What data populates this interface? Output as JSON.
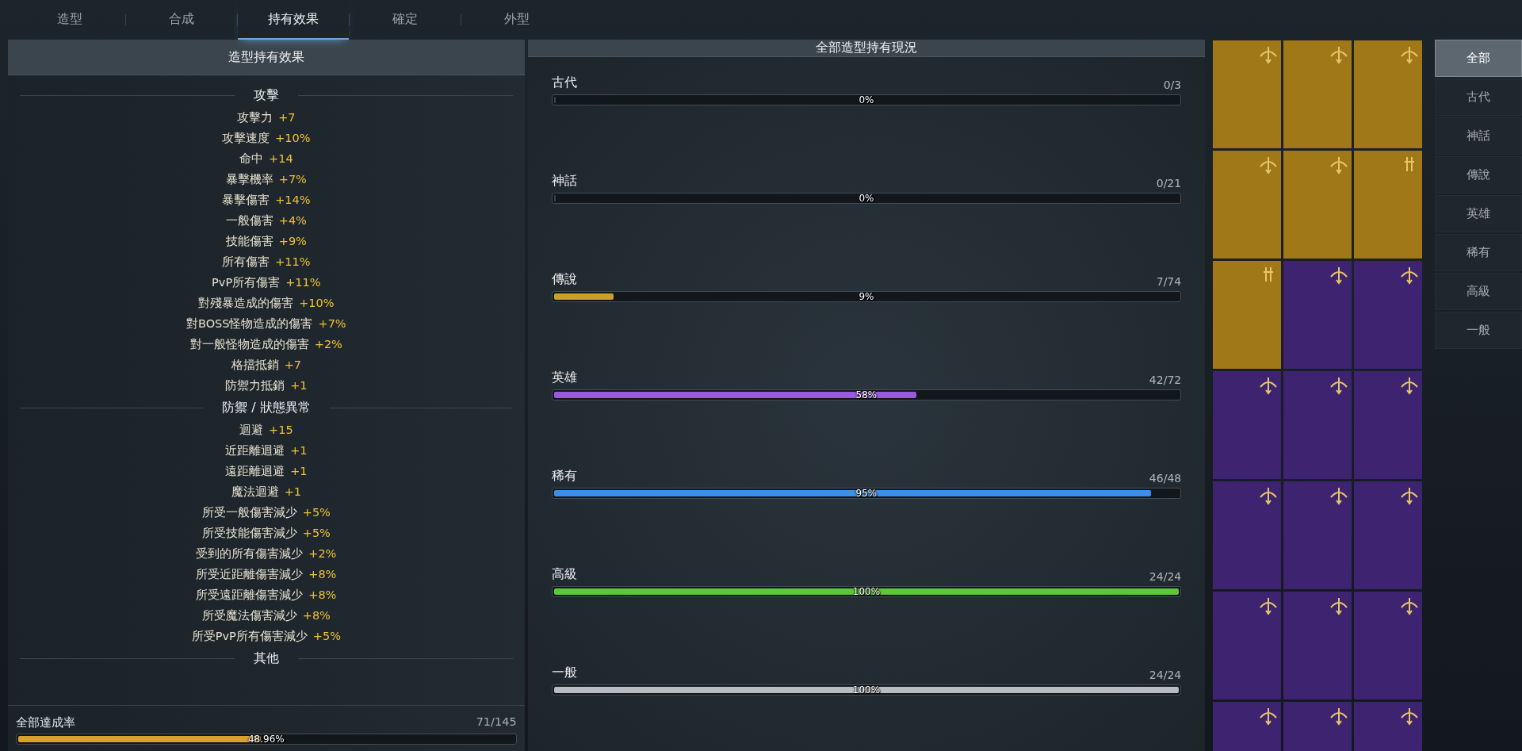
{
  "tabs": [
    {
      "label": "造型",
      "selected": false
    },
    {
      "label": "合成",
      "selected": false
    },
    {
      "label": "持有效果",
      "selected": true
    },
    {
      "label": "確定",
      "selected": false
    },
    {
      "label": "外型",
      "selected": false
    }
  ],
  "effects_panel": {
    "title": "造型持有效果",
    "sections": [
      {
        "title": "攻擊",
        "stats": [
          {
            "name": "攻擊力",
            "value": "+7"
          },
          {
            "name": "攻擊速度",
            "value": "+10%"
          },
          {
            "name": "命中",
            "value": "+14"
          },
          {
            "name": "暴擊機率",
            "value": "+7%"
          },
          {
            "name": "暴擊傷害",
            "value": "+14%"
          },
          {
            "name": "一般傷害",
            "value": "+4%"
          },
          {
            "name": "技能傷害",
            "value": "+9%"
          },
          {
            "name": "所有傷害",
            "value": "+11%"
          },
          {
            "name": "PvP所有傷害",
            "value": "+11%"
          },
          {
            "name": "對殘暴造成的傷害",
            "value": "+10%"
          },
          {
            "name": "對BOSS怪物造成的傷害",
            "value": "+7%"
          },
          {
            "name": "對一般怪物造成的傷害",
            "value": "+2%"
          },
          {
            "name": "格擋抵銷",
            "value": "+7"
          },
          {
            "name": "防禦力抵銷",
            "value": "+1"
          }
        ]
      },
      {
        "title": "防禦 / 狀態異常",
        "stats": [
          {
            "name": "迴避",
            "value": "+15"
          },
          {
            "name": "近距離迴避",
            "value": "+1"
          },
          {
            "name": "遠距離迴避",
            "value": "+1"
          },
          {
            "name": "魔法迴避",
            "value": "+1"
          },
          {
            "name": "所受一般傷害減少",
            "value": "+5%"
          },
          {
            "name": "所受技能傷害減少",
            "value": "+5%"
          },
          {
            "name": "受到的所有傷害減少",
            "value": "+2%"
          },
          {
            "name": "所受近距離傷害減少",
            "value": "+8%"
          },
          {
            "name": "所受遠距離傷害減少",
            "value": "+8%"
          },
          {
            "name": "所受魔法傷害減少",
            "value": "+8%"
          },
          {
            "name": "所受PvP所有傷害減少",
            "value": "+5%"
          }
        ]
      },
      {
        "title": "其他"
      }
    ],
    "total": {
      "label": "全部達成率",
      "count": "71/145",
      "percent": "48.96%",
      "level": 0.4896
    }
  },
  "collection_panel": {
    "title": "全部造型持有現況",
    "grades": [
      {
        "name": "古代",
        "count": "0/3",
        "percent": "0%",
        "level": 0
      },
      {
        "name": "神話",
        "count": "0/21",
        "percent": "0%",
        "level": 0
      },
      {
        "name": "傳說",
        "count": "7/74",
        "percent": "9%",
        "level": 0.095,
        "color": "#c9a02a"
      },
      {
        "name": "英雄",
        "count": "42/72",
        "percent": "58%",
        "level": 0.58,
        "color": "#9a5ae0"
      },
      {
        "name": "稀有",
        "count": "46/48",
        "percent": "95%",
        "level": 0.955,
        "color": "#3d8ee8"
      },
      {
        "name": "高級",
        "count": "24/24",
        "percent": "100%",
        "level": 1,
        "color": "#5cc83a"
      },
      {
        "name": "一般",
        "count": "24/24",
        "percent": "100%",
        "level": 1,
        "color": "#b8bcc0"
      }
    ]
  },
  "cards": [
    {
      "color": "#a07818",
      "kind": "bow"
    },
    {
      "color": "#a07818",
      "kind": "bow"
    },
    {
      "color": "#a07818",
      "kind": "bow"
    },
    {
      "color": "#a07818",
      "kind": "bow"
    },
    {
      "color": "#a07818",
      "kind": "bow"
    },
    {
      "color": "#a07818",
      "kind": "dagger"
    },
    {
      "color": "#a07818",
      "kind": "dagger"
    },
    {
      "color": "#3e2470",
      "kind": "bow"
    },
    {
      "color": "#3e2470",
      "kind": "bow"
    },
    {
      "color": "#3e2470",
      "kind": "bow"
    },
    {
      "color": "#3e2470",
      "kind": "bow"
    },
    {
      "color": "#3e2470",
      "kind": "bow"
    },
    {
      "color": "#3e2470",
      "kind": "bow"
    },
    {
      "color": "#3e2470",
      "kind": "bow"
    },
    {
      "color": "#3e2470",
      "kind": "bow"
    },
    {
      "color": "#3e2470",
      "kind": "bow"
    },
    {
      "color": "#3e2470",
      "kind": "bow"
    },
    {
      "color": "#3e2470",
      "kind": "bow"
    },
    {
      "color": "#3e2470",
      "kind": "bow"
    },
    {
      "color": "#3e2470",
      "kind": "bow"
    },
    {
      "color": "#3e2470",
      "kind": "bow"
    }
  ],
  "filters": [
    {
      "label": "全部",
      "selected": true
    },
    {
      "label": "古代",
      "selected": false
    },
    {
      "label": "神話",
      "selected": false
    },
    {
      "label": "傳說",
      "selected": false
    },
    {
      "label": "英雄",
      "selected": false
    },
    {
      "label": "稀有",
      "selected": false
    },
    {
      "label": "高級",
      "selected": false
    },
    {
      "label": "一般",
      "selected": false
    }
  ]
}
